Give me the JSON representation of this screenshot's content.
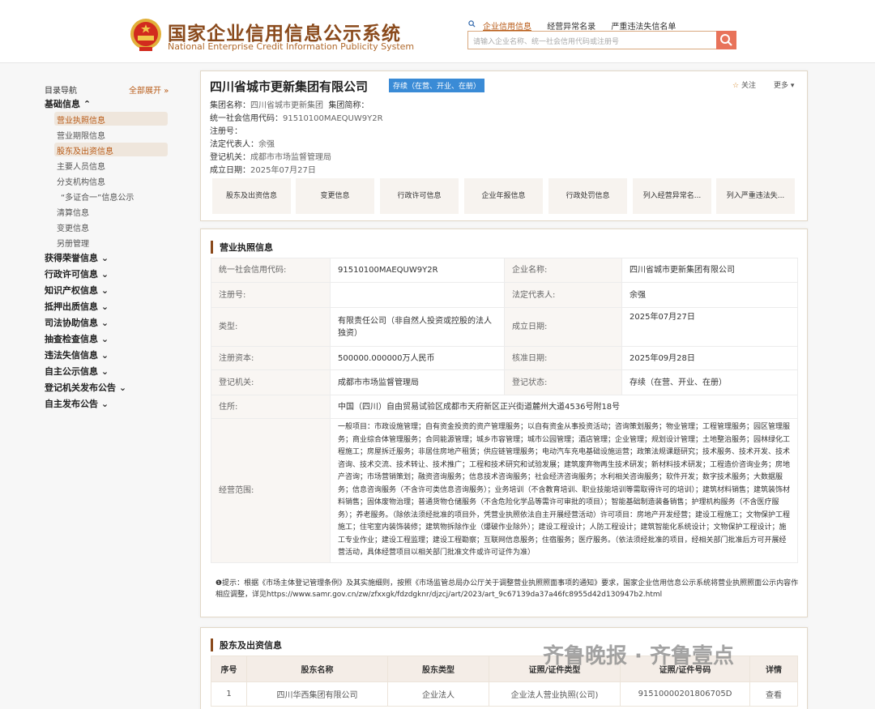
{
  "header": {
    "title_cn": "国家企业信用信息公示系统",
    "title_en": "National Enterprise Credit Information Publicity System",
    "links": [
      "企业信用信息",
      "经营异常名录",
      "严重违法失信名单"
    ],
    "search_placeholder": "请输入企业名称、统一社会信用代码或注册号"
  },
  "sidebar": {
    "heading": "目录导航",
    "expand_all": "全部展开",
    "basic_section": "基础信息",
    "basic_items": [
      "营业执照信息",
      "营业期限信息",
      "股东及出资信息",
      "主要人员信息",
      "分支机构信息",
      "“多证合一”信息公示",
      "清算信息",
      "变更信息",
      "另册管理"
    ],
    "sections": [
      "获得荣誉信息",
      "行政许可信息",
      "知识产权信息",
      "抵押出质信息",
      "司法协助信息",
      "抽查检查信息",
      "违法失信信息",
      "自主公示信息",
      "登记机关发布公告",
      "自主发布公告"
    ]
  },
  "company": {
    "name": "四川省城市更新集团有限公司",
    "status": "存续（在营、开业、在册）",
    "follow": "关注",
    "more": "更多",
    "group_name_label": "集团名称：",
    "group_name": "四川省城市更新集团",
    "group_short_label": "集团简称：",
    "credit_code_label": "统一社会信用代码：",
    "credit_code": "91510100MAEQUW9Y2R",
    "reg_no_label": "注册号：",
    "legal_rep_label": "法定代表人：",
    "legal_rep": "余强",
    "authority_label": "登记机关：",
    "authority": "成都市市场监督管理局",
    "established_label": "成立日期：",
    "established": "2025年07月27日",
    "tabs": [
      "股东及出资信息",
      "变更信息",
      "行政许可信息",
      "企业年报信息",
      "行政处罚信息",
      "列入经营异常名...",
      "列入严重违法失..."
    ]
  },
  "license": {
    "title": "营业执照信息",
    "rows": [
      {
        "k1": "统一社会信用代码:",
        "v1": "91510100MAEQUW9Y2R",
        "k2": "企业名称:",
        "v2": "四川省城市更新集团有限公司"
      },
      {
        "k1": "注册号:",
        "v1": "",
        "k2": "法定代表人:",
        "v2": "余强"
      },
      {
        "k1": "类型:",
        "v1": "有限责任公司（非自然人投资或控股的法人独资）",
        "k2": "成立日期:",
        "v2": "2025年07月27日"
      },
      {
        "k1": "注册资本:",
        "v1": "500000.000000万人民币",
        "k2": "核准日期:",
        "v2": "2025年09月28日"
      },
      {
        "k1": "登记机关:",
        "v1": "成都市市场监督管理局",
        "k2": "登记状态:",
        "v2": "存续（在营、开业、在册）"
      }
    ],
    "address_label": "住所:",
    "address": "中国（四川）自由贸易试验区成都市天府新区正兴街道麓州大道4536号附18号",
    "scope_label": "经营范围:",
    "scope": "一般项目：市政设施管理；自有资金投资的资产管理服务；以自有资金从事投资活动；咨询策划服务；物业管理；工程管理服务；园区管理服务；商业综合体管理服务；合同能源管理；城乡市容管理；城市公园管理；酒店管理；企业管理；规划设计管理；土地整治服务；园林绿化工程施工；房屋拆迁服务；非居住房地产租赁；供应链管理服务；电动汽车充电基础设施运营；政策法规课题研究；技术服务、技术开发、技术咨询、技术交流、技术转让、技术推广；工程和技术研究和试验发展；建筑废弃物再生技术研发；新材料技术研发；工程造价咨询业务；房地产咨询；市场营销策划；融资咨询服务；信息技术咨询服务；社会经济咨询服务；水利相关咨询服务；软件开发；数字技术服务；大数据服务；信息咨询服务（不含许可类信息咨询服务）；业务培训（不含教育培训、职业技能培训等需取得许可的培训）；建筑材料销售；建筑装饰材料销售；固体废物治理；普通货物仓储服务（不含危险化学品等需许可审批的项目）；智能基础制造装备销售；护理机构服务（不含医疗服务）；养老服务。（除依法须经批准的项目外，凭营业执照依法自主开展经营活动）许可项目：房地产开发经营；建设工程施工；文物保护工程施工；住宅室内装饰装修；建筑物拆除作业（爆破作业除外）；建设工程设计；人防工程设计；建筑智能化系统设计；文物保护工程设计；施工专业作业；建设工程监理；建设工程勘察；互联网信息服务；住宿服务；医疗服务。（依法须经批准的项目，经相关部门批准后方可开展经营活动，具体经营项目以相关部门批准文件或许可证件为准）",
    "tip": "❶提示：根据《市场主体登记管理条例》及其实施细则，按照《市场监管总局办公厅关于调整营业执照照面事项的通知》要求，国家企业信用信息公示系统将营业执照照面公示内容作相应调整，详见https://www.samr.gov.cn/zw/zfxxgk/fdzdgknr/djzcj/art/2023/art_9c67139da37a46fc8955d42d130947b2.html"
  },
  "shareholders": {
    "title": "股东及出资信息",
    "headers": [
      "序号",
      "股东名称",
      "股东类型",
      "证照/证件类型",
      "证照/证件号码",
      "详情"
    ],
    "rows": [
      {
        "no": "1",
        "name": "四川华西集团有限公司",
        "type": "企业法人",
        "doc_type": "企业法人营业执照(公司)",
        "doc_no": "91510000201806705D",
        "detail": "查看"
      }
    ]
  },
  "watermark": "齐鲁晚报 · 齐鲁壹点",
  "colors": {
    "accent": "#8a4a1c",
    "badge": "#3a8bd6",
    "search_button": "#e8735a",
    "link": "#d4882e"
  }
}
